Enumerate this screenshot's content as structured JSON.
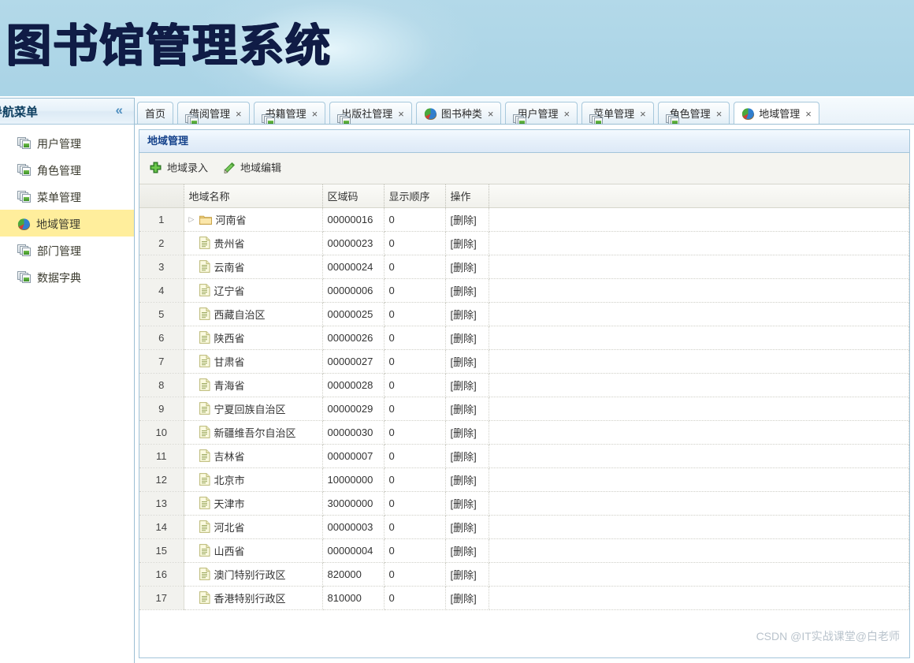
{
  "banner": {
    "title": "图书馆管理系统"
  },
  "sidebar": {
    "header": {
      "title": "导航菜单",
      "collapse_icon": "chevron-double-left-icon",
      "collapse_glyph": "«"
    },
    "items": [
      {
        "label": "用户管理",
        "icon": "stacked-window-icon",
        "active": false
      },
      {
        "label": "角色管理",
        "icon": "stacked-window-icon",
        "active": false
      },
      {
        "label": "菜单管理",
        "icon": "stacked-window-icon",
        "active": false
      },
      {
        "label": "地域管理",
        "icon": "pie-chart-icon",
        "active": true
      },
      {
        "label": "部门管理",
        "icon": "stacked-window-icon",
        "active": false
      },
      {
        "label": "数据字典",
        "icon": "stacked-window-icon",
        "active": false
      }
    ]
  },
  "tabs": [
    {
      "label": "首页",
      "icon": null,
      "closable": false,
      "active": false
    },
    {
      "label": "借阅管理",
      "icon": "stacked-window-icon",
      "closable": true,
      "active": false
    },
    {
      "label": "书籍管理",
      "icon": "stacked-window-icon",
      "closable": true,
      "active": false
    },
    {
      "label": "出版社管理",
      "icon": "stacked-window-icon",
      "closable": true,
      "active": false
    },
    {
      "label": "图书种类",
      "icon": "pie-chart-icon",
      "closable": true,
      "active": false
    },
    {
      "label": "用户管理",
      "icon": "stacked-window-icon",
      "closable": true,
      "active": false
    },
    {
      "label": "菜单管理",
      "icon": "stacked-window-icon",
      "closable": true,
      "active": false
    },
    {
      "label": "角色管理",
      "icon": "stacked-window-icon",
      "closable": true,
      "active": false
    },
    {
      "label": "地域管理",
      "icon": "pie-chart-icon",
      "closable": true,
      "active": true
    }
  ],
  "close_glyph": "×",
  "panel": {
    "title": "地域管理",
    "toolbar": [
      {
        "label": "地域录入",
        "icon": "plus-circle-icon"
      },
      {
        "label": "地域编辑",
        "icon": "pencil-icon"
      }
    ],
    "columns": [
      "",
      "地域名称",
      "区域码",
      "显示顺序",
      "操作",
      ""
    ],
    "delete_label": "[删除]",
    "rows": [
      {
        "n": "1",
        "name": "河南省",
        "code": "00000016",
        "order": "0",
        "icon": "folder-icon",
        "expandable": true
      },
      {
        "n": "2",
        "name": "贵州省",
        "code": "00000023",
        "order": "0",
        "icon": "file-icon",
        "expandable": false
      },
      {
        "n": "3",
        "name": "云南省",
        "code": "00000024",
        "order": "0",
        "icon": "file-icon",
        "expandable": false
      },
      {
        "n": "4",
        "name": "辽宁省",
        "code": "00000006",
        "order": "0",
        "icon": "file-icon",
        "expandable": false
      },
      {
        "n": "5",
        "name": "西藏自治区",
        "code": "00000025",
        "order": "0",
        "icon": "file-icon",
        "expandable": false
      },
      {
        "n": "6",
        "name": "陕西省",
        "code": "00000026",
        "order": "0",
        "icon": "file-icon",
        "expandable": false
      },
      {
        "n": "7",
        "name": "甘肃省",
        "code": "00000027",
        "order": "0",
        "icon": "file-icon",
        "expandable": false
      },
      {
        "n": "8",
        "name": "青海省",
        "code": "00000028",
        "order": "0",
        "icon": "file-icon",
        "expandable": false
      },
      {
        "n": "9",
        "name": "宁夏回族自治区",
        "code": "00000029",
        "order": "0",
        "icon": "file-icon",
        "expandable": false
      },
      {
        "n": "10",
        "name": "新疆维吾尔自治区",
        "code": "00000030",
        "order": "0",
        "icon": "file-icon",
        "expandable": false
      },
      {
        "n": "11",
        "name": "吉林省",
        "code": "00000007",
        "order": "0",
        "icon": "file-icon",
        "expandable": false
      },
      {
        "n": "12",
        "name": "北京市",
        "code": "10000000",
        "order": "0",
        "icon": "file-icon",
        "expandable": false
      },
      {
        "n": "13",
        "name": "天津市",
        "code": "30000000",
        "order": "0",
        "icon": "file-icon",
        "expandable": false
      },
      {
        "n": "14",
        "name": "河北省",
        "code": "00000003",
        "order": "0",
        "icon": "file-icon",
        "expandable": false
      },
      {
        "n": "15",
        "name": "山西省",
        "code": "00000004",
        "order": "0",
        "icon": "file-icon",
        "expandable": false
      },
      {
        "n": "16",
        "name": "澳门特别行政区",
        "code": "820000",
        "order": "0",
        "icon": "file-icon",
        "expandable": false
      },
      {
        "n": "17",
        "name": "香港特别行政区",
        "code": "810000",
        "order": "0",
        "icon": "file-icon",
        "expandable": false
      }
    ]
  },
  "watermark": "CSDN @IT实战课堂@白老师",
  "colors": {
    "banner_bg": "#aed7e8",
    "banner_text": "#101c46",
    "panel_title_text": "#15428b",
    "active_nav_bg": "#ffee9c",
    "toolbar_bg": "#f4f4f0",
    "border": "#a3c5da"
  }
}
